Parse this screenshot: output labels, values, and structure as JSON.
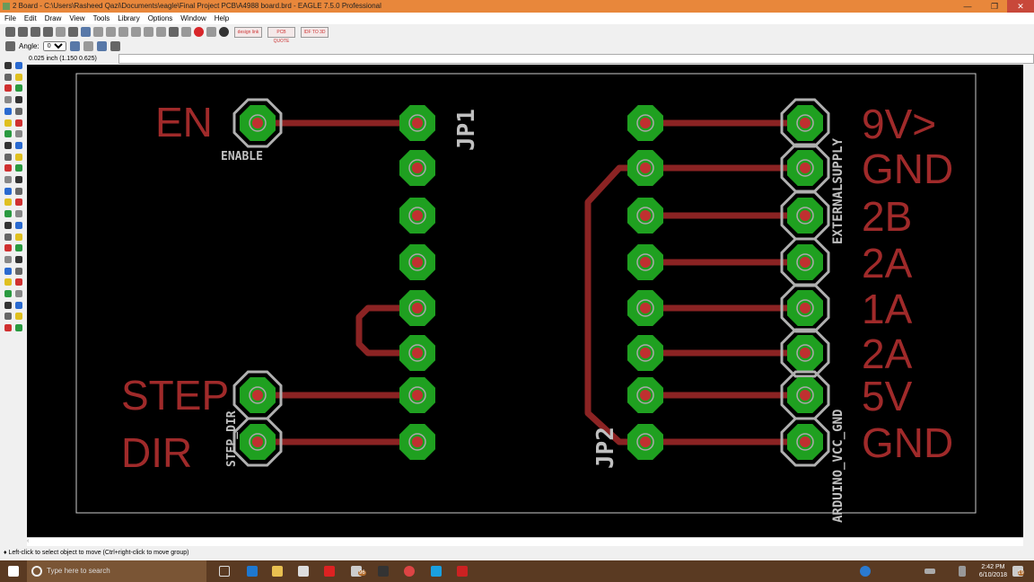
{
  "window": {
    "title": "2 Board - C:\\Users\\Rasheed Qazi\\Documents\\eagle\\Final Project PCB\\A4988 board.brd - EAGLE 7.5.0 Professional",
    "minimize": "—",
    "restore": "❐",
    "close": "✕"
  },
  "menu": [
    "File",
    "Edit",
    "Draw",
    "View",
    "Tools",
    "Library",
    "Options",
    "Window",
    "Help"
  ],
  "toolbar": {
    "brand_buttons": [
      "design link",
      "PCB QUOTE",
      "IDF TO 3D"
    ],
    "angle_label": "Angle:",
    "angle_value": "0"
  },
  "coordinate_readout": "0.025 inch (1.150 0.625)",
  "status_text": "♦ Left-click to select object to move (Ctrl+right-click to move group)",
  "taskbar": {
    "search_placeholder": "Type here to search",
    "mail_badge": "96",
    "time": "2:42 PM",
    "date": "6/10/2018",
    "notification_count": "19"
  },
  "colors": {
    "trace": "#8b2323",
    "pad": "#1fa020",
    "pad_outline": "#b0b0b0",
    "silk": "#c0c0c0",
    "label": "#a02a2a"
  },
  "board": {
    "left_labels": [
      {
        "text": "EN",
        "row": 0
      },
      {
        "text": "STEP",
        "row": 6
      },
      {
        "text": "DIR",
        "row": 7
      }
    ],
    "right_labels": [
      "9V>",
      "GND",
      "2B",
      "2A",
      "1A",
      "2A",
      "5V",
      "GND"
    ],
    "silk": {
      "enable": "ENABLE",
      "step_dir": "STEP_DIR",
      "jp1": "JP1",
      "jp2": "JP2",
      "external_supply": "EXTERNALSUPPLY",
      "arduino": "ARDUINO_VCC_GND"
    }
  }
}
